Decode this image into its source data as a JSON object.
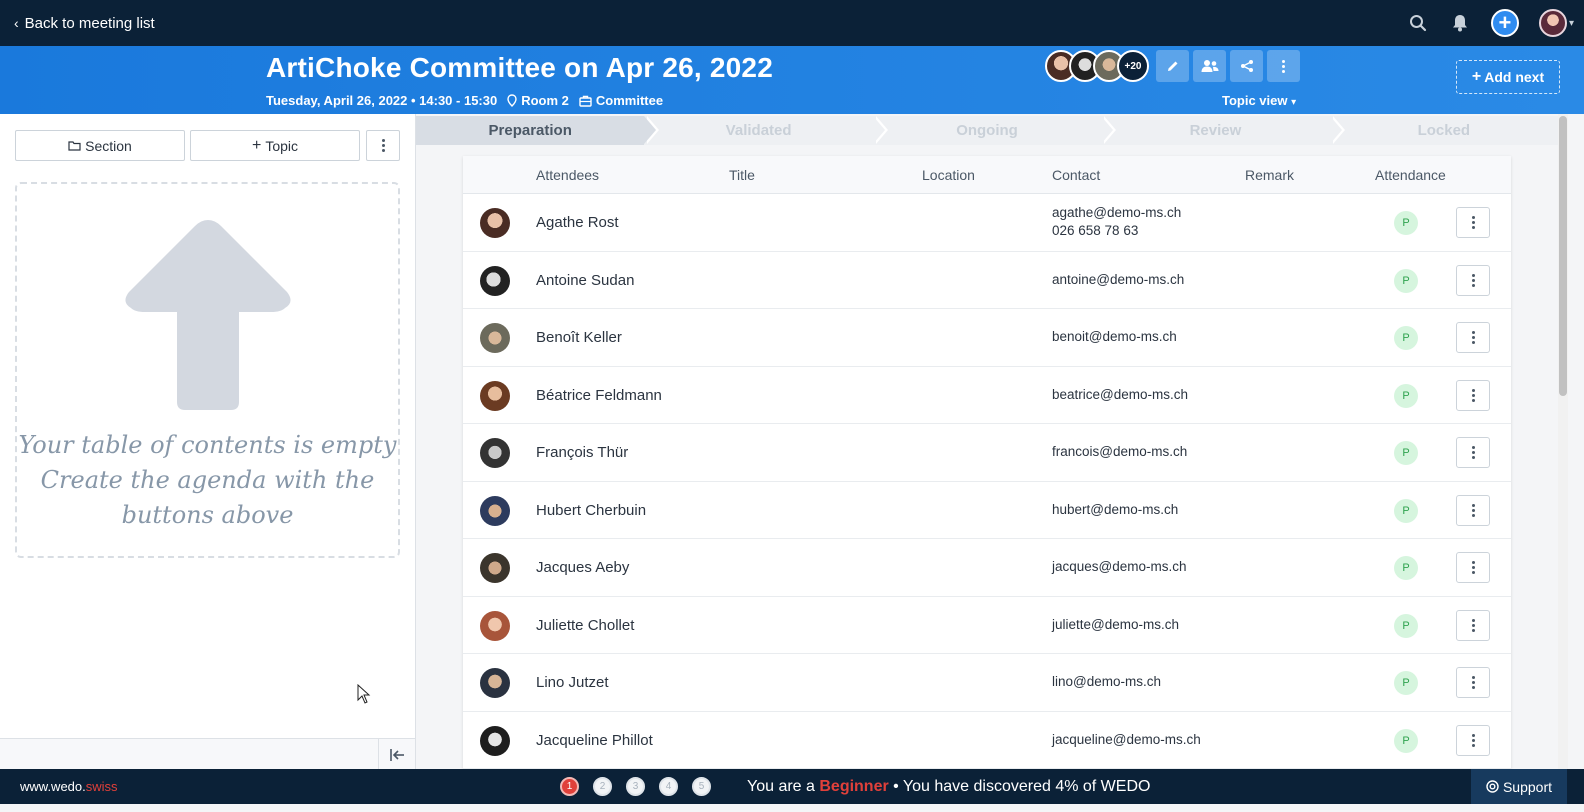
{
  "topnav": {
    "back_label": "Back to meeting list"
  },
  "header": {
    "title": "ArtiChoke Committee on Apr 26, 2022",
    "date": "Tuesday, April 26, 2022 • 14:30 - 15:30",
    "room": "Room 2",
    "group": "Committee",
    "extra_attendees": "+20",
    "topic_view": "Topic view",
    "add_next": "Add next"
  },
  "leftpanel": {
    "section_button": "Section",
    "topic_button": "Topic",
    "empty_line1": "Your table of contents is empty",
    "empty_line2": "Create the agenda with the buttons above"
  },
  "stepper": [
    "Preparation",
    "Validated",
    "Ongoing",
    "Review",
    "Locked"
  ],
  "table": {
    "headers": [
      "Attendees",
      "Title",
      "Location",
      "Contact",
      "Remark",
      "Attendance"
    ],
    "rows": [
      {
        "name": "Agathe Rost",
        "email": "agathe@demo-ms.ch",
        "phone": "026 658 78 63",
        "attendance": "P"
      },
      {
        "name": "Antoine Sudan",
        "email": "antoine@demo-ms.ch",
        "phone": "",
        "attendance": "P"
      },
      {
        "name": "Benoît Keller",
        "email": "benoit@demo-ms.ch",
        "phone": "",
        "attendance": "P"
      },
      {
        "name": "Béatrice Feldmann",
        "email": "beatrice@demo-ms.ch",
        "phone": "",
        "attendance": "P"
      },
      {
        "name": "François Thür",
        "email": "francois@demo-ms.ch",
        "phone": "",
        "attendance": "P"
      },
      {
        "name": "Hubert Cherbuin",
        "email": "hubert@demo-ms.ch",
        "phone": "",
        "attendance": "P"
      },
      {
        "name": "Jacques Aeby",
        "email": "jacques@demo-ms.ch",
        "phone": "",
        "attendance": "P"
      },
      {
        "name": "Juliette Chollet",
        "email": "juliette@demo-ms.ch",
        "phone": "",
        "attendance": "P"
      },
      {
        "name": "Lino Jutzet",
        "email": "lino@demo-ms.ch",
        "phone": "",
        "attendance": "P"
      },
      {
        "name": "Jacqueline Phillot",
        "email": "jacqueline@demo-ms.ch",
        "phone": "",
        "attendance": "P"
      }
    ]
  },
  "bottombar": {
    "site_part1": "www.wedo.",
    "site_part2": "swiss",
    "levels": [
      "1",
      "2",
      "3",
      "4",
      "5"
    ],
    "progress_prefix": "You are a ",
    "level_name": "Beginner",
    "progress_suffix": " • You have discovered 4% of WEDO",
    "support": "Support"
  },
  "colors": {
    "nav_bg": "#0b2137",
    "header_blue": "#1a79dc",
    "accent_red": "#e0403a",
    "present_green": "#d6f5de"
  }
}
